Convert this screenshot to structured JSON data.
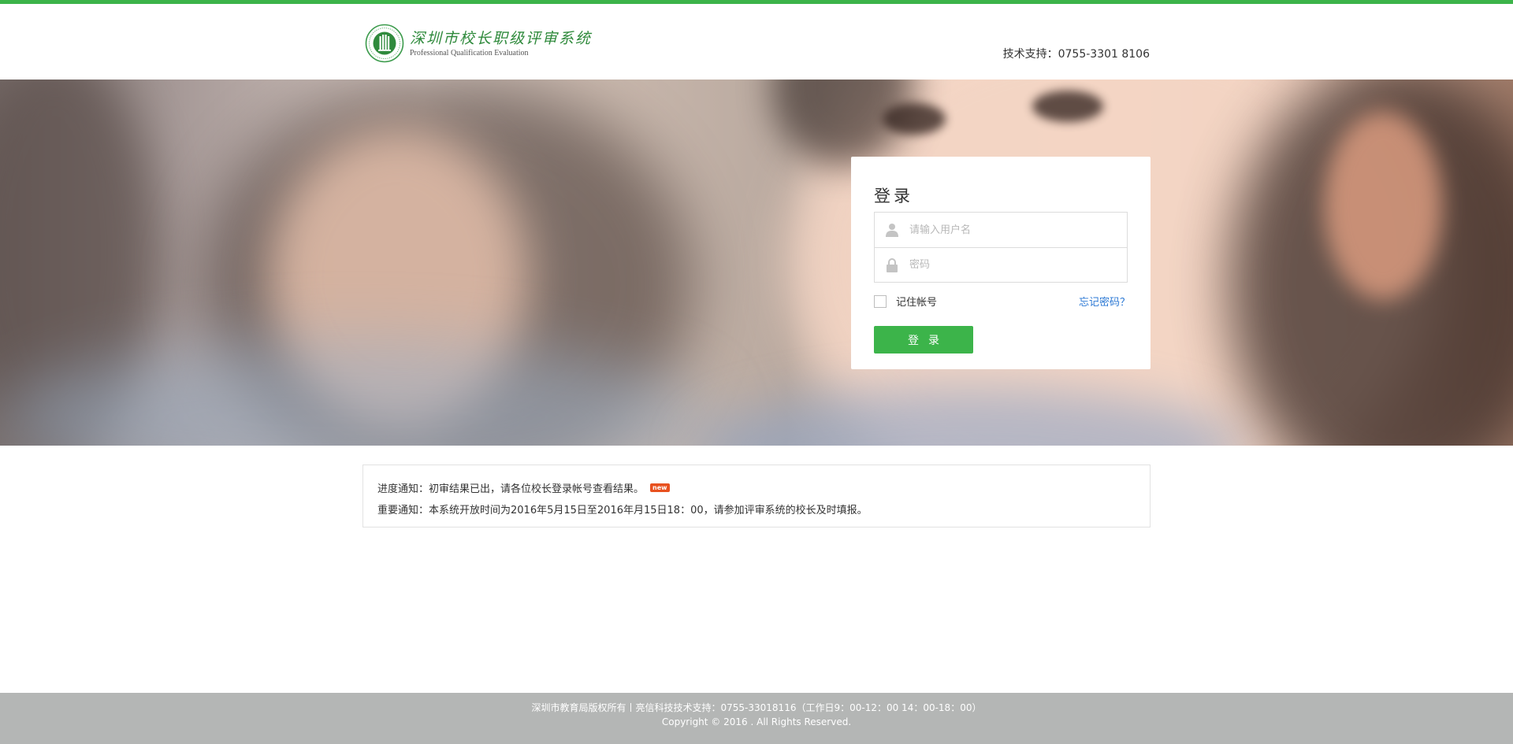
{
  "header": {
    "logo_title": "深圳市校长职级评审系统",
    "logo_subtitle": "Professional Qualification Evaluation",
    "tech_support": "技术支持：0755-3301 8106"
  },
  "login": {
    "title": "登录",
    "username_placeholder": "请输入用户名",
    "password_placeholder": "密码",
    "remember_label": "记住帐号",
    "forgot_label": "忘记密码？",
    "submit_label": "登录"
  },
  "notices": {
    "progress": "进度通知：初审结果已出，请各位校长登录帐号查看结果。",
    "new_badge": "new",
    "important": "重要通知：本系统开放时间为2016年5月15日至2016年月15日18：00，请参加评审系统的校长及时填报。"
  },
  "footer": {
    "line1": "深圳市教育局版权所有丨亮信科技技术支持：0755-33018116（工作日9：00-12：00 14：00-18：00）",
    "line2": "Copyright © 2016 . All Rights Reserved."
  },
  "colors": {
    "brand_green": "#3cb44a",
    "link_blue": "#2b78d4",
    "footer_gray": "#b4b6b5",
    "badge_orange": "#e8511f"
  },
  "icons": {
    "logo": "school-emblem-icon",
    "username": "user-icon",
    "password": "lock-icon"
  }
}
